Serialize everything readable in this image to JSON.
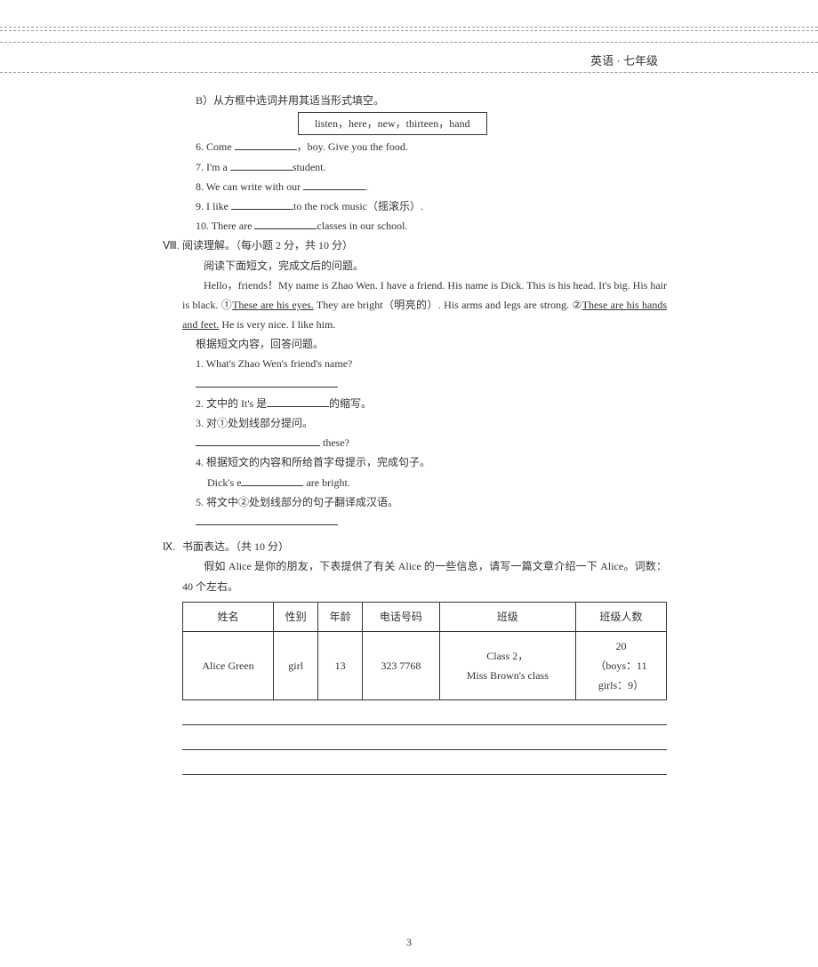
{
  "header": {
    "title": "英语 · 七年级"
  },
  "sectionB": {
    "label": "B）从方框中选词并用其适当形式填空。",
    "wordbox": "listen，here，new，thirteen，hand",
    "q6_pre": "6. Come ",
    "q6_post": "，boy. Give you the food.",
    "q7_pre": "7. I'm a ",
    "q7_post": "student.",
    "q8_pre": "8. We can write with our ",
    "q8_post": ".",
    "q9_pre": "9. I like ",
    "q9_post": "to the rock music（摇滚乐）.",
    "q10_pre": "10. There are ",
    "q10_post": "classes in our school."
  },
  "sectionVIII": {
    "num": "Ⅷ.",
    "title": "阅读理解。（每小题 2 分，共 10 分）",
    "instr": "阅读下面短文，完成文后的问题。",
    "passage": "Hello，friends！My name is Zhao Wen. I have a friend. His name is Dick. This is his head. It's big. His hair is black. ①These are his eyes. They are bright（明亮的）. His arms and legs are strong. ②These are his hands and feet. He is very nice. I like him.",
    "after": "根据短文内容，回答问题。",
    "q1": "1. What's Zhao Wen's friend's name?",
    "q2_pre": "2. 文中的 It's 是",
    "q2_post": "的缩写。",
    "q3": "3. 对①处划线部分提问。",
    "q3_post": " these?",
    "q4": "4. 根据短文的内容和所给首字母提示，完成句子。",
    "q4_line_pre": "Dick's e",
    "q4_line_post": " are bright.",
    "q5": "5. 将文中②处划线部分的句子翻译成汉语。"
  },
  "sectionIX": {
    "num": "Ⅸ.",
    "title": "书面表达。（共 10 分）",
    "instr": "假如 Alice 是你的朋友，下表提供了有关 Alice 的一些信息，请写一篇文章介绍一下 Alice。词数：40 个左右。",
    "table": {
      "headers": [
        "姓名",
        "性别",
        "年龄",
        "电话号码",
        "班级",
        "班级人数"
      ],
      "row": {
        "name": "Alice Green",
        "gender": "girl",
        "age": "13",
        "phone": "323 7768",
        "class_l1": "Class 2，",
        "class_l2": "Miss Brown's class",
        "count_l1": "20",
        "count_l2": "（boys：11",
        "count_l3": "girls：9）"
      }
    }
  },
  "pagenum": "3"
}
